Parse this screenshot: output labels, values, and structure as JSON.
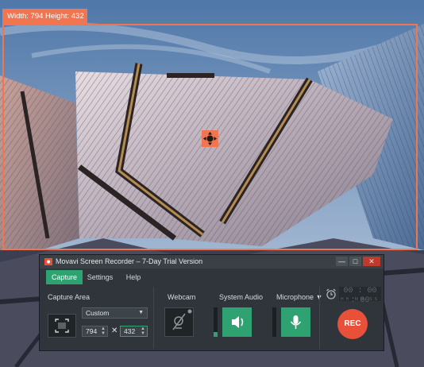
{
  "capture": {
    "size_label": "Width: 794  Height: 432",
    "accent_color": "#f07550"
  },
  "recorder": {
    "title": "Movavi Screen Recorder – 7-Day Trial Version",
    "window_buttons": {
      "minimize": "—",
      "restore": "□",
      "close": "✕"
    },
    "tabs": [
      {
        "label": "Capture",
        "active": true
      },
      {
        "label": "Settings",
        "active": false
      },
      {
        "label": "Help",
        "active": false
      }
    ],
    "capture_area": {
      "label": "Capture Area",
      "preset": "Custom",
      "width": "794",
      "height": "432",
      "times_sign": "✕"
    },
    "webcam": {
      "label": "Webcam",
      "icon": "camera-off-icon"
    },
    "system_audio": {
      "label": "System Audio",
      "icon": "speaker-icon",
      "level": 0.15
    },
    "microphone": {
      "label": "Microphone ▼",
      "icon": "microphone-icon",
      "level": 0.0
    },
    "timer": {
      "display": "00 : 00 : 00",
      "units": "HH MM SS"
    },
    "rec_label": "REC",
    "accent_color": "#2ea270",
    "rec_color": "#e8503a"
  }
}
